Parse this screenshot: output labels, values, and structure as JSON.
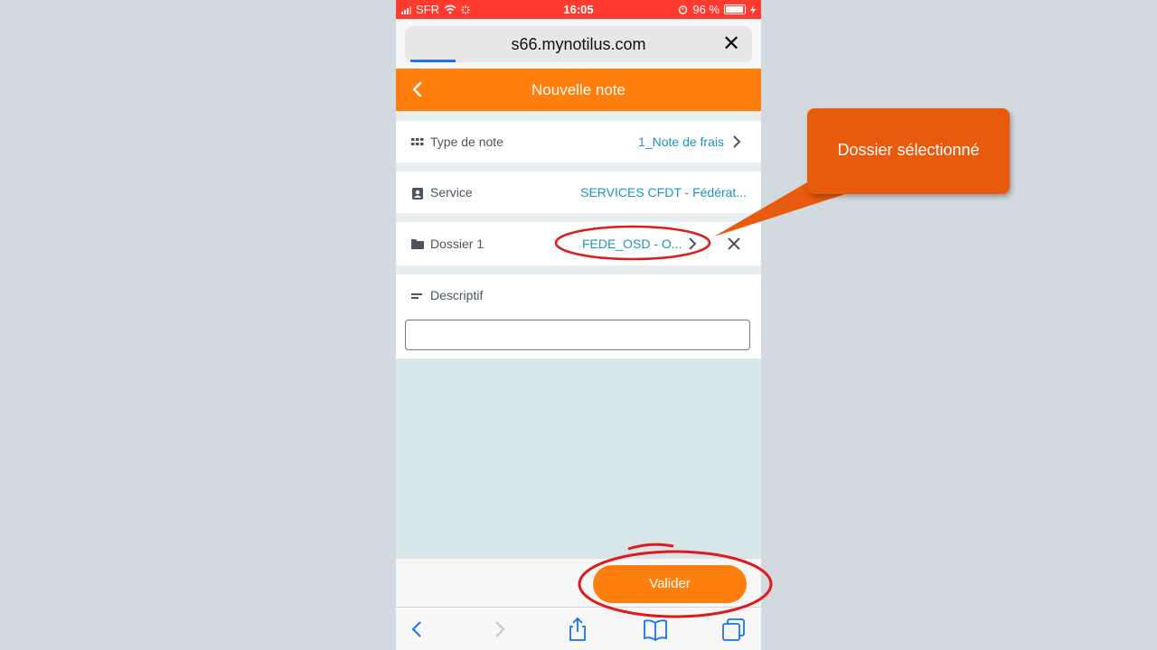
{
  "status_bar": {
    "carrier": "SFR",
    "time": "16:05",
    "battery": "96 %"
  },
  "browser": {
    "url": "s66.mynotilus.com"
  },
  "app_header": {
    "title": "Nouvelle note"
  },
  "form": {
    "type_de_note": {
      "label": "Type de note",
      "value": "1_Note de frais"
    },
    "service": {
      "label": "Service",
      "value": "SERVICES CFDT - Fédérat..."
    },
    "dossier": {
      "label": "Dossier 1",
      "value": "FEDE_OSD - O..."
    },
    "descriptif": {
      "label": "Descriptif",
      "value": ""
    }
  },
  "footer": {
    "valider_label": "Valider"
  },
  "annotation": {
    "callout_text": "Dossier sélectionné"
  },
  "colors": {
    "accent": "#ff7f0e",
    "status_bar": "#ff3b30",
    "link": "#1b95c0",
    "callout": "#e85a0d",
    "highlight_ring": "#e0191b"
  }
}
